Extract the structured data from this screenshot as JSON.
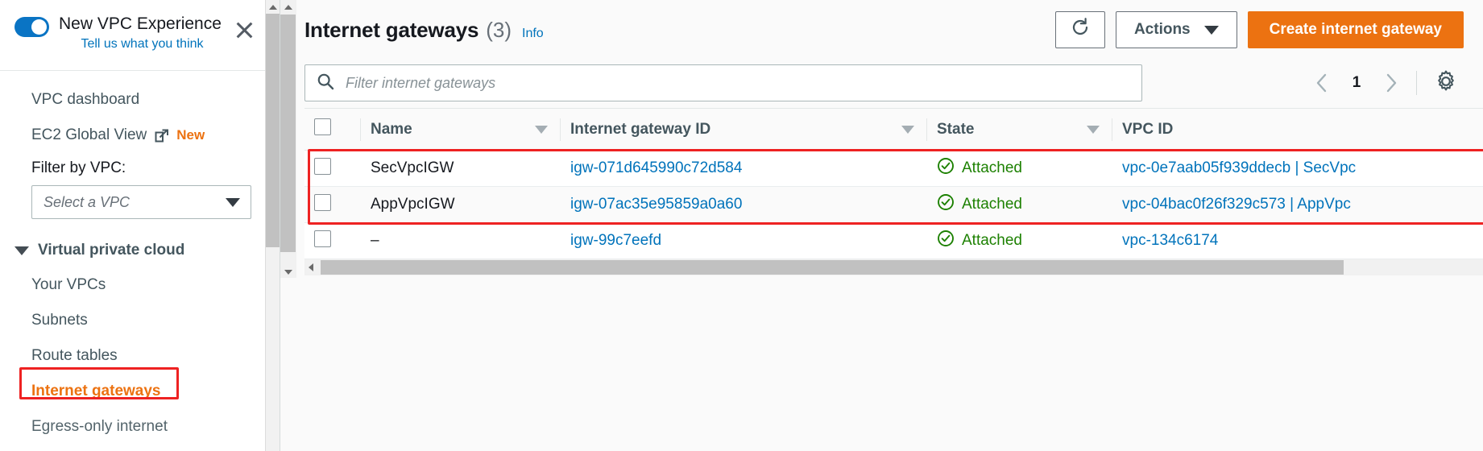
{
  "sidebar": {
    "promo": {
      "title": "New VPC Experience",
      "subtitle": "Tell us what you think",
      "toggle_state": "on",
      "close_label": "×"
    },
    "items": [
      {
        "label": "VPC dashboard"
      },
      {
        "label": "EC2 Global View",
        "badge": "New",
        "external": true
      }
    ],
    "filter": {
      "label": "Filter by VPC:",
      "placeholder": "Select a VPC",
      "value": ""
    },
    "group": {
      "label": "Virtual private cloud",
      "expanded": true,
      "items": [
        {
          "label": "Your VPCs",
          "active": false
        },
        {
          "label": "Subnets",
          "active": false
        },
        {
          "label": "Route tables",
          "active": false
        },
        {
          "label": "Internet gateways",
          "active": true
        },
        {
          "label": "Egress-only internet",
          "active": false
        }
      ]
    }
  },
  "header": {
    "title": "Internet gateways",
    "count": "(3)",
    "info_label": "Info",
    "refresh_icon": "refresh-icon",
    "actions_label": "Actions",
    "create_label": "Create internet gateway"
  },
  "filter_bar": {
    "search_placeholder": "Filter internet gateways",
    "search_value": "",
    "search_icon": "search-icon",
    "prev_label": "‹",
    "page_number": "1",
    "next_label": "›",
    "settings_icon": "gear-icon"
  },
  "table": {
    "columns": [
      {
        "key": "name",
        "label": "Name",
        "sortable": true
      },
      {
        "key": "igw_id",
        "label": "Internet gateway ID",
        "sortable": true
      },
      {
        "key": "state",
        "label": "State",
        "sortable": true
      },
      {
        "key": "vpc_id",
        "label": "VPC ID",
        "sortable": true
      }
    ],
    "rows": [
      {
        "name": "SecVpcIGW",
        "igw_id": "igw-071d645990c72d584",
        "state": "Attached",
        "vpc_id": "vpc-0e7aab05f939ddecb | SecVpc",
        "selected": false,
        "highlighted": true
      },
      {
        "name": "AppVpcIGW",
        "igw_id": "igw-07ac35e95859a0a60",
        "state": "Attached",
        "vpc_id": "vpc-04bac0f26f329c573 | AppVpc",
        "selected": false,
        "highlighted": true
      },
      {
        "name": "–",
        "igw_id": "igw-99c7eefd",
        "state": "Attached",
        "vpc_id": "vpc-134c6174",
        "selected": false,
        "highlighted": false
      }
    ]
  },
  "colors": {
    "accent_orange": "#ec7211",
    "link_blue": "#0073bb",
    "state_green": "#1d8102",
    "annotation_red": "#ee2222",
    "text_dark": "#16191f",
    "text_muted": "#44565e"
  }
}
